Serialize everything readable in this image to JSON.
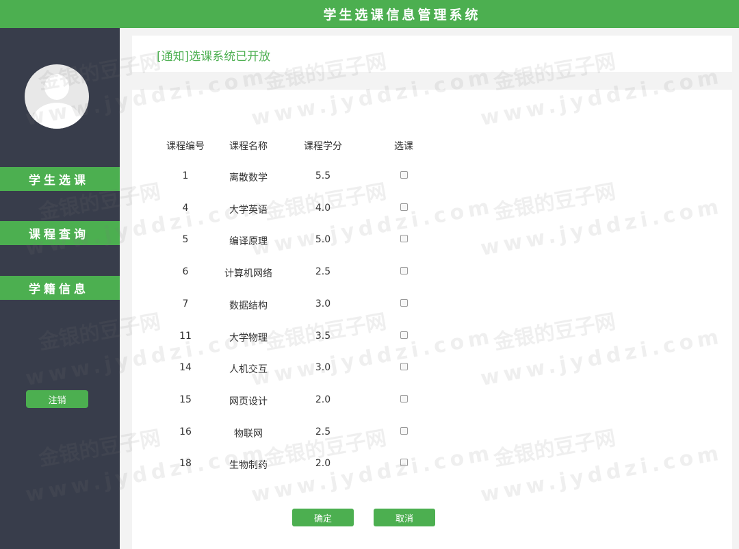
{
  "header": {
    "title": "学生选课信息管理系统"
  },
  "sidebar": {
    "items": [
      {
        "label": "学生选课"
      },
      {
        "label": "课程查询"
      },
      {
        "label": "学籍信息"
      }
    ],
    "logout_label": "注销"
  },
  "notice": {
    "text": "[通知]选课系统已开放"
  },
  "table": {
    "headers": [
      "课程编号",
      "课程名称",
      "课程学分",
      "选课"
    ],
    "rows": [
      {
        "id": "1",
        "name": "离散数学",
        "credit": "5.5"
      },
      {
        "id": "4",
        "name": "大学英语",
        "credit": "4.0"
      },
      {
        "id": "5",
        "name": "编译原理",
        "credit": "5.0"
      },
      {
        "id": "6",
        "name": "计算机网络",
        "credit": "2.5"
      },
      {
        "id": "7",
        "name": "数据结构",
        "credit": "3.0"
      },
      {
        "id": "11",
        "name": "大学物理",
        "credit": "3.5"
      },
      {
        "id": "14",
        "name": "人机交互",
        "credit": "3.0"
      },
      {
        "id": "15",
        "name": "网页设计",
        "credit": "2.0"
      },
      {
        "id": "16",
        "name": "物联网",
        "credit": "2.5"
      },
      {
        "id": "18",
        "name": "生物制药",
        "credit": "2.0"
      }
    ]
  },
  "buttons": {
    "confirm": "确定",
    "cancel": "取消"
  },
  "watermark": {
    "line1": "金银的豆子网",
    "line2": "www.jyddzi.com"
  }
}
